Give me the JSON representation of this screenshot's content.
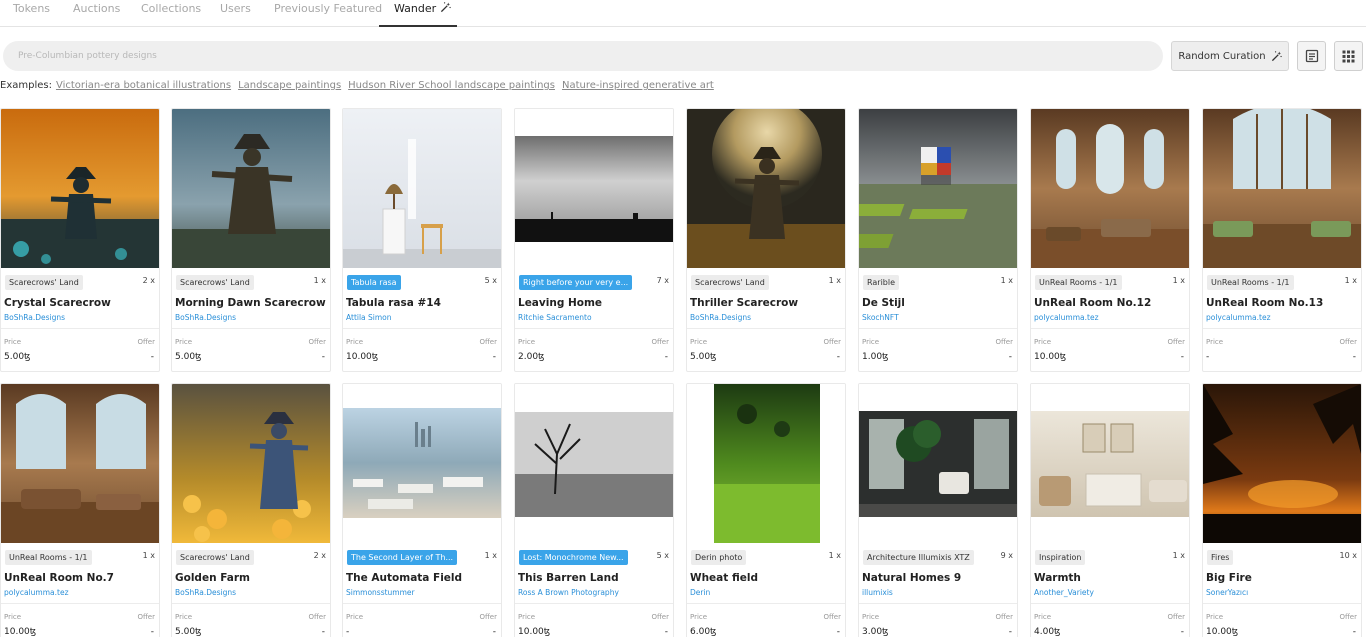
{
  "tabs": [
    {
      "label": "Tokens"
    },
    {
      "label": "Auctions"
    },
    {
      "label": "Collections"
    },
    {
      "label": "Users"
    },
    {
      "label": "Previously Featured"
    },
    {
      "label": "Wander",
      "active": true
    }
  ],
  "search": {
    "placeholder": "Pre-Columbian pottery designs"
  },
  "random_curation_label": "Random Curation",
  "examples": {
    "label": "Examples:",
    "links": [
      "Victorian-era botanical illustrations",
      "Landscape paintings",
      "Hudson River School landscape paintings",
      "Nature-inspired generative art"
    ]
  },
  "price_label": "Price",
  "offer_label": "Offer",
  "colors": {
    "accent": "#3aa4e9",
    "creator_link": "#2a8fd8"
  },
  "cards": [
    {
      "collection": "Scarecrows' Land",
      "count": "2 x",
      "title": "Crystal Scarecrow",
      "creator": "BoShRa.Designs",
      "price": "5.00ꜩ",
      "offer": "-"
    },
    {
      "collection": "Scarecrows' Land",
      "count": "1 x",
      "title": "Morning Dawn Scarecrow",
      "creator": "BoShRa.Designs",
      "price": "5.00ꜩ",
      "offer": "-"
    },
    {
      "collection": "Tabula rasa",
      "count": "5 x",
      "title": "Tabula rasa #14",
      "creator": "Attila Simon",
      "price": "10.00ꜩ",
      "offer": "-",
      "badge_blue": true
    },
    {
      "collection": "Right before your very e...",
      "count": "7 x",
      "title": "Leaving Home",
      "creator": "Ritchie Sacramento",
      "price": "2.00ꜩ",
      "offer": "-",
      "badge_blue": true
    },
    {
      "collection": "Scarecrows' Land",
      "count": "1 x",
      "title": "Thriller Scarecrow",
      "creator": "BoShRa.Designs",
      "price": "5.00ꜩ",
      "offer": "-"
    },
    {
      "collection": "Rarible",
      "count": "1 x",
      "title": "De Stijl",
      "creator": "SkochNFT",
      "price": "1.00ꜩ",
      "offer": "-"
    },
    {
      "collection": "UnReal Rooms - 1/1",
      "count": "1 x",
      "title": "UnReal Room No.12",
      "creator": "polycalumma.tez",
      "price": "10.00ꜩ",
      "offer": "-"
    },
    {
      "collection": "UnReal Rooms - 1/1",
      "count": "1 x",
      "title": "UnReal Room No.13",
      "creator": "polycalumma.tez",
      "price": "-",
      "offer": "-"
    },
    {
      "collection": "UnReal Rooms - 1/1",
      "count": "1 x",
      "title": "UnReal Room No.7",
      "creator": "polycalumma.tez",
      "price": "10.00ꜩ",
      "offer": "-"
    },
    {
      "collection": "Scarecrows' Land",
      "count": "2 x",
      "title": "Golden Farm",
      "creator": "BoShRa.Designs",
      "price": "5.00ꜩ",
      "offer": "-"
    },
    {
      "collection": "The Second Layer of Th...",
      "count": "1 x",
      "title": "The Automata Field",
      "creator": "Simmonsstummer",
      "price": "-",
      "offer": "-",
      "badge_blue": true
    },
    {
      "collection": "Lost: Monochrome New...",
      "count": "5 x",
      "title": "This Barren Land",
      "creator": "Ross A Brown Photography",
      "price": "10.00ꜩ",
      "offer": "-",
      "badge_blue": true
    },
    {
      "collection": "Derin photo",
      "count": "1 x",
      "title": "Wheat field",
      "creator": "Derin",
      "price": "6.00ꜩ",
      "offer": "-"
    },
    {
      "collection": "Architecture Illumixis XTZ",
      "count": "9 x",
      "title": "Natural Homes 9",
      "creator": "illumixis",
      "price": "3.00ꜩ",
      "offer": "-"
    },
    {
      "collection": "Inspiration",
      "count": "1 x",
      "title": "Warmth",
      "creator": "Another_Variety",
      "price": "4.00ꜩ",
      "offer": "-"
    },
    {
      "collection": "Fires",
      "count": "10 x",
      "title": "Big Fire",
      "creator": "SonerYazıcı",
      "price": "10.00ꜩ",
      "offer": "-"
    }
  ]
}
